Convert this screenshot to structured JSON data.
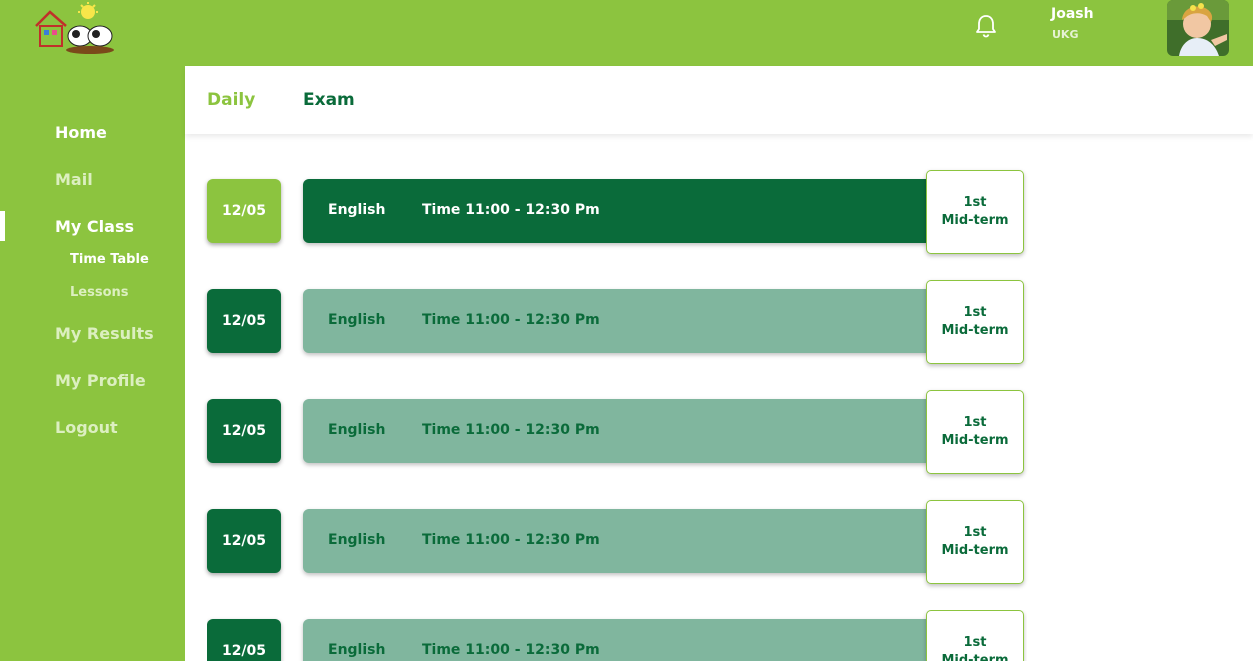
{
  "colors": {
    "brand_green": "#8cc43f",
    "dark_green": "#0a6b3a",
    "muted_green": "#80b69e",
    "white": "#ffffff"
  },
  "header": {
    "logo": "school-logo",
    "notification_icon": "bell-icon",
    "user": {
      "name": "Joash",
      "class": "UKG"
    }
  },
  "sidebar": {
    "items": [
      {
        "label": "Home"
      },
      {
        "label": "Mail"
      },
      {
        "label": "My Class",
        "sub": [
          {
            "label": "Time Table"
          },
          {
            "label": "Lessons"
          }
        ]
      },
      {
        "label": "My Results"
      },
      {
        "label": "My Profile"
      },
      {
        "label": "Logout"
      }
    ]
  },
  "tabs": [
    {
      "label": "Daily"
    },
    {
      "label": "Exam"
    }
  ],
  "schedule": [
    {
      "date": "12/05",
      "subject": "English",
      "time": "Time 11:00 - 12:30 Pm",
      "exam_line1": "1st",
      "exam_line2": "Mid-term",
      "active": true
    },
    {
      "date": "12/05",
      "subject": "English",
      "time": "Time 11:00 - 12:30 Pm",
      "exam_line1": "1st",
      "exam_line2": "Mid-term",
      "active": false
    },
    {
      "date": "12/05",
      "subject": "English",
      "time": "Time 11:00 - 12:30 Pm",
      "exam_line1": "1st",
      "exam_line2": "Mid-term",
      "active": false
    },
    {
      "date": "12/05",
      "subject": "English",
      "time": "Time 11:00 - 12:30 Pm",
      "exam_line1": "1st",
      "exam_line2": "Mid-term",
      "active": false
    },
    {
      "date": "12/05",
      "subject": "English",
      "time": "Time 11:00 - 12:30 Pm",
      "exam_line1": "1st",
      "exam_line2": "Mid-term",
      "active": false
    }
  ]
}
